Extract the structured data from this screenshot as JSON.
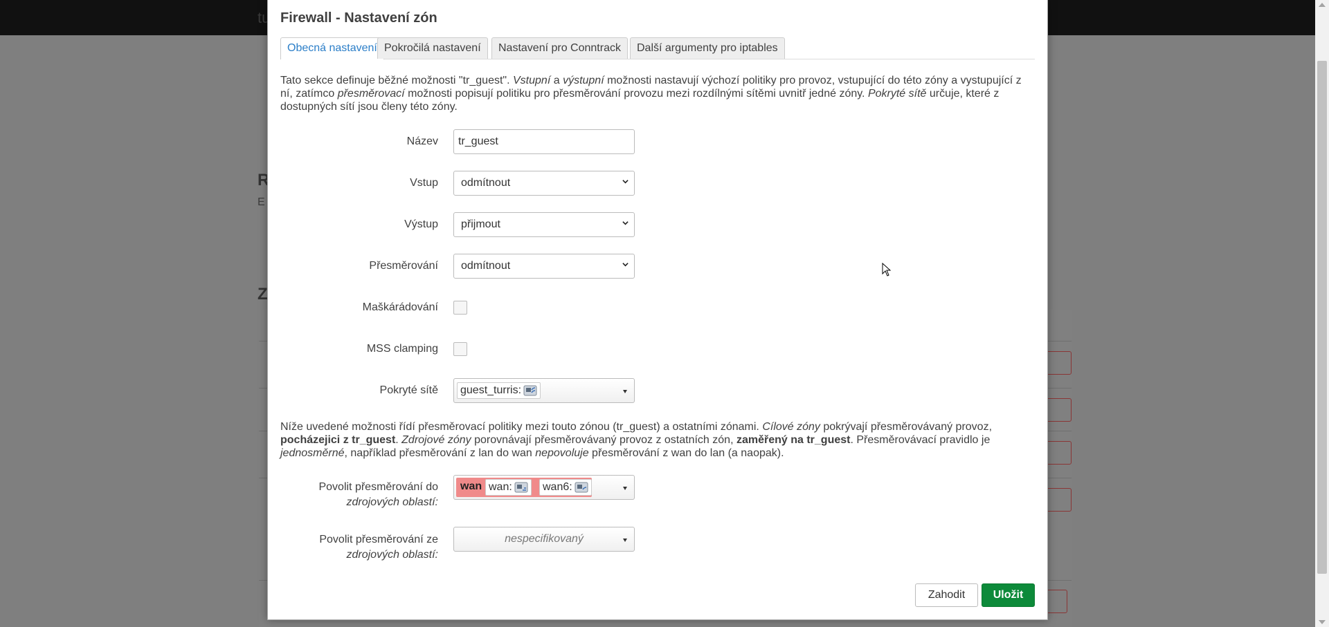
{
  "background": {
    "brand": "tu",
    "heading_r": "R",
    "text_e": "E",
    "heading_z": "Z"
  },
  "modal": {
    "title": "Firewall - Nastavení zón",
    "tabs": [
      {
        "label": "Obecná nastavení",
        "active": true
      },
      {
        "label": "Pokročilá nastavení",
        "active": false
      },
      {
        "label": "Nastavení pro Conntrack",
        "active": false
      },
      {
        "label": "Další argumenty pro iptables",
        "active": false
      }
    ],
    "description1": {
      "p1": "Tato sekce definuje běžné možnosti \"tr_guest\". ",
      "i1": "Vstupní",
      "p2": " a ",
      "i2": "výstupní",
      "p3": " možnosti nastavují výchozí politiky pro provoz, vstupující do této zóny a vystupující z ní, zatímco ",
      "i3": "přesměrovací",
      "p4": " možnosti popisují politiku pro přesměrování provozu mezi rozdílnými sítěmi uvnitř jedné zóny. ",
      "i4": "Pokryté sítě",
      "p5": " určuje, které z dostupných sítí jsou členy této zóny."
    },
    "fields": {
      "name": {
        "label": "Název",
        "value": "tr_guest"
      },
      "input": {
        "label": "Vstup",
        "value": "odmítnout"
      },
      "output": {
        "label": "Výstup",
        "value": "přijmout"
      },
      "forward": {
        "label": "Přesměrování",
        "value": "odmítnout"
      },
      "masq": {
        "label": "Maškárádování",
        "checked": false
      },
      "mss": {
        "label": "MSS clamping",
        "checked": false
      },
      "networks": {
        "label": "Pokryté sítě",
        "chip": "guest_turris:"
      }
    },
    "description2": {
      "p1": "Níže uvedené možnosti řídí přesměrovací politiky mezi touto zónou (tr_guest) a ostatními zónami. ",
      "i1": "Cílové zóny",
      "p2": " pokrývají přesměrovávaný provoz, ",
      "b1": "pocházejici z tr_guest",
      "p3": ". ",
      "i2": "Zdrojové zóny",
      "p4": " porovnávají přesměrovávaný provoz z ostatních zón, ",
      "b2": "zaměřený na tr_guest",
      "p5": ". Přesměrovávací pravidlo je ",
      "i3": "jednosměrné",
      "p6": ", například přesměrování z lan do wan ",
      "i4": "nepovoluje",
      "p7": " přesměrování z wan do lan (a naopak)."
    },
    "forward_to": {
      "label_line1": "Povolit přesměrování do",
      "label_line2": "zdrojových oblastí:",
      "zone": "wan",
      "chips": [
        "wan:",
        "wan6:"
      ]
    },
    "forward_from": {
      "label_line1": "Povolit přesměrování ze",
      "label_line2": "zdrojových oblastí:",
      "placeholder": "nespecifikovaný"
    },
    "buttons": {
      "reset": "Zahodit",
      "save": "Uložit"
    }
  },
  "colors": {
    "accent_tab": "#2b7ec8",
    "save_button": "#0d8a3a",
    "zone_wan": "#f08a8a"
  }
}
